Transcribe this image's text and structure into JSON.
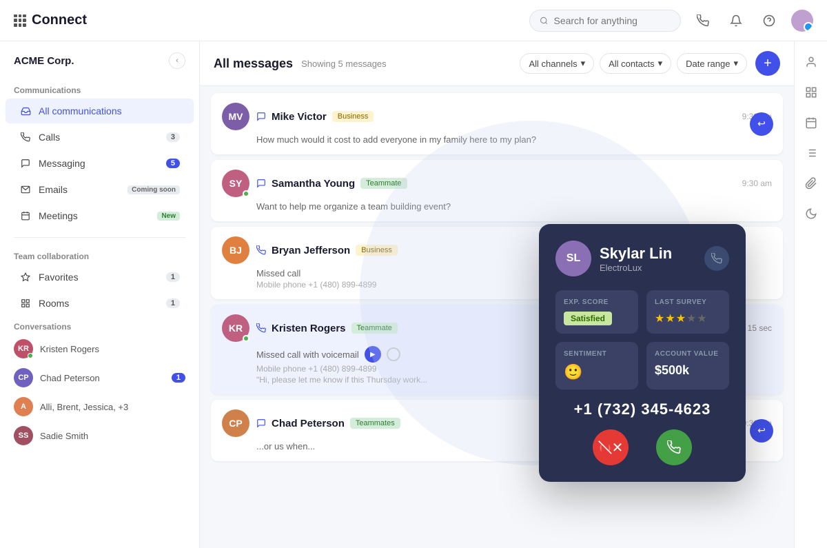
{
  "app": {
    "name": "Connect",
    "company": "ACME Corp."
  },
  "topbar": {
    "search_placeholder": "Search for anything"
  },
  "sidebar": {
    "communications_title": "Communications",
    "all_communications": "All communications",
    "calls_label": "Calls",
    "calls_count": "3",
    "messaging_label": "Messaging",
    "messaging_count": "5",
    "emails_label": "Emails",
    "emails_tag": "Coming soon",
    "meetings_label": "Meetings",
    "meetings_tag": "New",
    "team_title": "Team collaboration",
    "favorites_label": "Favorites",
    "favorites_count": "1",
    "rooms_label": "Rooms",
    "rooms_count": "1",
    "conversations_title": "Conversations",
    "conversations": [
      {
        "name": "Kristen Rogers",
        "color": "#c0506a"
      },
      {
        "name": "Chad Peterson",
        "color": "#7060c0",
        "count": "1"
      },
      {
        "name": "Alli, Brent, Jessica, +3",
        "color": "#e08050"
      },
      {
        "name": "Sadie Smith",
        "color": "#a05060"
      }
    ]
  },
  "content": {
    "title": "All messages",
    "showing": "Showing 5 messages",
    "filters": [
      "All channels",
      "All contacts",
      "Date range"
    ],
    "add_button": "+"
  },
  "messages": [
    {
      "id": "mike-victor",
      "avatar_initials": "MV",
      "avatar_color": "#7b5ea7",
      "name": "Mike Victor",
      "tag": "Business",
      "tag_type": "business",
      "time": "9:30 am",
      "body": "How much would it cost to add everyone in my family here to my plan?",
      "channel": "message",
      "has_reply": true
    },
    {
      "id": "samantha-young",
      "avatar_initials": "SY",
      "avatar_color": "#c06080",
      "name": "Samantha Young",
      "tag": "Teammate",
      "tag_type": "teammate",
      "time": "9:30 am",
      "body": "Want to help me organize a team building event?",
      "channel": "message",
      "has_reply": false,
      "has_online": true
    },
    {
      "id": "bryan-jefferson",
      "avatar_initials": "BJ",
      "avatar_color": "#e08040",
      "name": "Bryan Jefferson",
      "tag": "Business",
      "tag_type": "business",
      "body": "Missed call",
      "sub": "Mobile phone +1 (480) 899-4899",
      "channel": "call",
      "has_reply": false
    },
    {
      "id": "kristen-rogers",
      "avatar_initials": "KR",
      "avatar_color": "#c06080",
      "name": "Kristen Rogers",
      "tag": "Teammate",
      "tag_type": "teammate",
      "time": "15 sec",
      "body": "Missed call with voicemail",
      "sub": "Mobile phone +1 (480) 899-4899",
      "sub2": "\"Hi, please let me know if this Thursday work...",
      "channel": "call",
      "has_voicemail": true,
      "has_reply": false,
      "has_online": true
    },
    {
      "id": "chad-peterson",
      "avatar_initials": "CP",
      "avatar_color": "#d0804a",
      "name": "Chad Peterson",
      "tag": "Teammates",
      "tag_type": "teammates",
      "time": "9:30 am",
      "body": "...or us when...",
      "channel": "message",
      "has_reply": true
    }
  ],
  "call_card": {
    "name": "Skylar Lin",
    "company": "ElectroLux",
    "avatar_initials": "SL",
    "avatar_color": "#8b6fb5",
    "exp_score_label": "EXP. SCORE",
    "exp_score_value": "Satisfied",
    "last_survey_label": "LAST SURVEY",
    "stars_filled": 3,
    "stars_total": 5,
    "sentiment_label": "SENTIMENT",
    "sentiment_emoji": "🙂",
    "account_value_label": "ACCOUNT VALUE",
    "account_value": "$500k",
    "phone_number": "+1 (732) 345-4623",
    "hangup_label": "✕",
    "answer_label": "📞"
  },
  "right_sidebar_icons": [
    "person-icon",
    "grid-icon",
    "calendar-icon",
    "list-icon",
    "paperclip-icon",
    "moon-icon"
  ]
}
